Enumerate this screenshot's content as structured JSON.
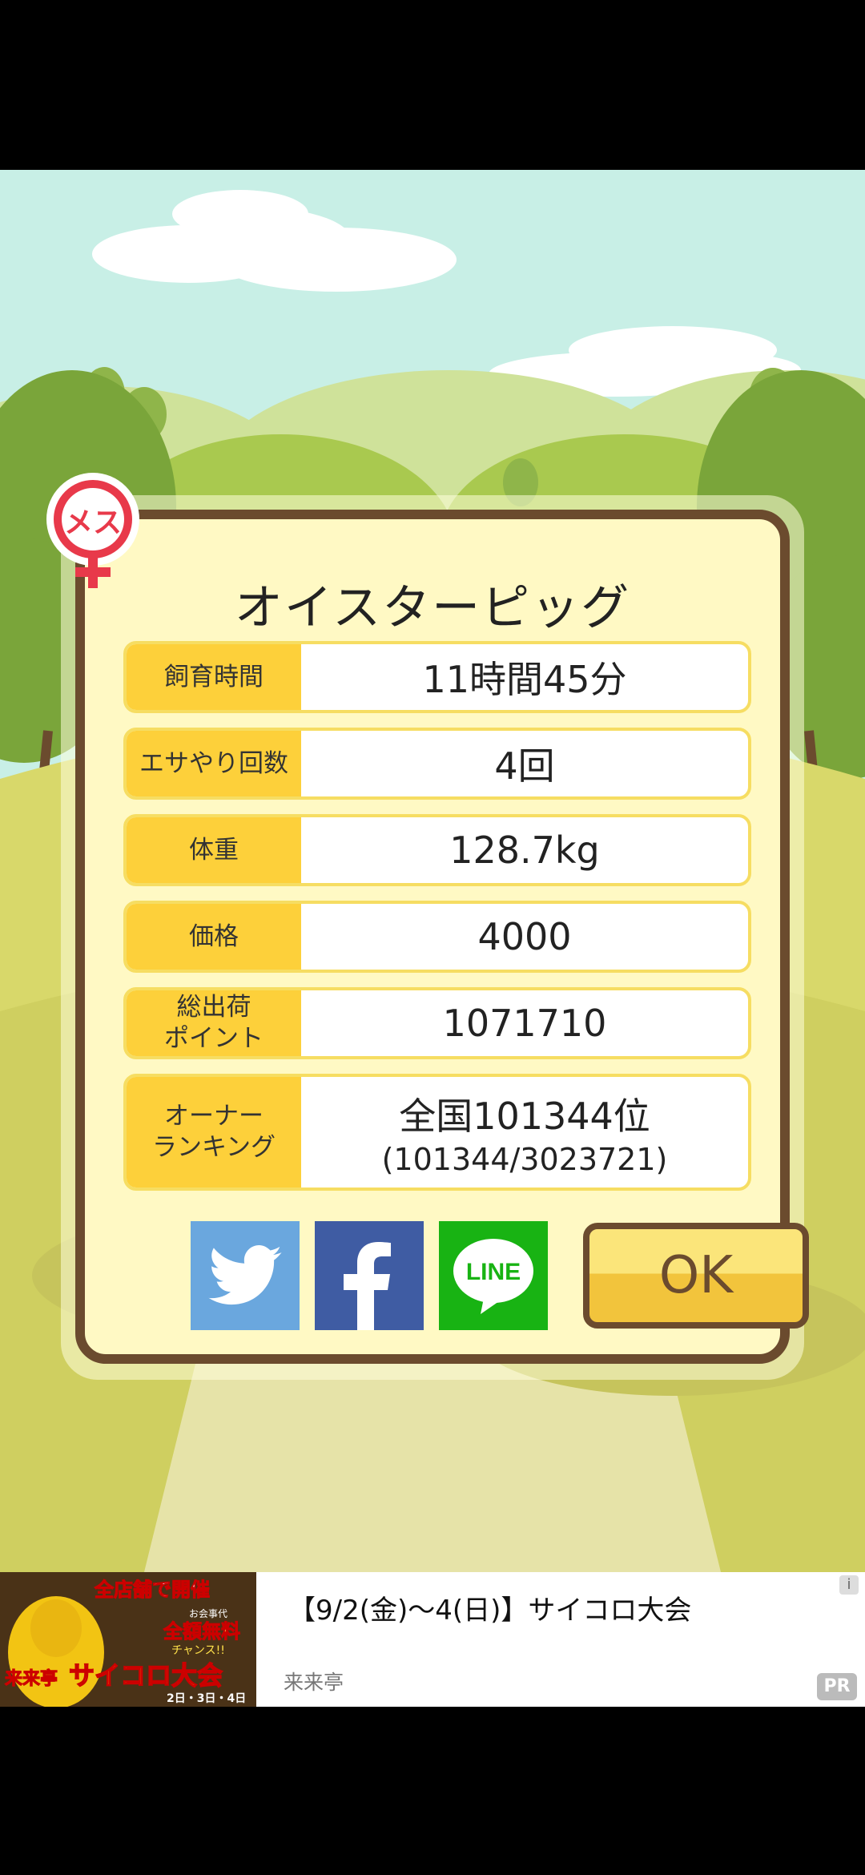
{
  "colors": {
    "sky": "#c8efe6",
    "hills": "#a9c94f",
    "ground": "#d8d86a",
    "dialog_fill": "#fff9c4",
    "dialog_border": "#6b4b2e",
    "label_fill": "#fdd03a",
    "twitter": "#6aa7de",
    "facebook": "#3f5ca3",
    "line": "#18b313",
    "ok_button": "#f2c43c"
  },
  "badge": {
    "label": "メス",
    "icon": "female-symbol-icon"
  },
  "pig_name": "オイスターピッグ",
  "stats": [
    {
      "label": "飼育時間",
      "value": "11時間45分"
    },
    {
      "label": "エサやり回数",
      "value": "4回"
    },
    {
      "label": "体重",
      "value": "128.7kg"
    },
    {
      "label": "価格",
      "value": "4000"
    },
    {
      "label": "総出荷\nポイント",
      "value": "1071710"
    },
    {
      "label": "オーナー\nランキング",
      "value": "全国101344位",
      "sub": "(101344/3023721)"
    }
  ],
  "share": {
    "twitter_icon": "twitter-bird-icon",
    "facebook_icon": "facebook-f-icon",
    "line_icon": "line-logo-icon",
    "line_text": "LINE"
  },
  "ok_label": "OK",
  "ad": {
    "image_texts": [
      "全店舗で開催",
      "お会事代",
      "全額無料",
      "チャンス!!",
      "来来亭",
      "サイコロ大会",
      "2日・3日・4日"
    ],
    "title": "【9/2(金)～4(日)】サイコロ大会",
    "source": "来来亭",
    "pr_badge": "PR",
    "info_icon": "info-icon",
    "info_glyph": "i"
  }
}
